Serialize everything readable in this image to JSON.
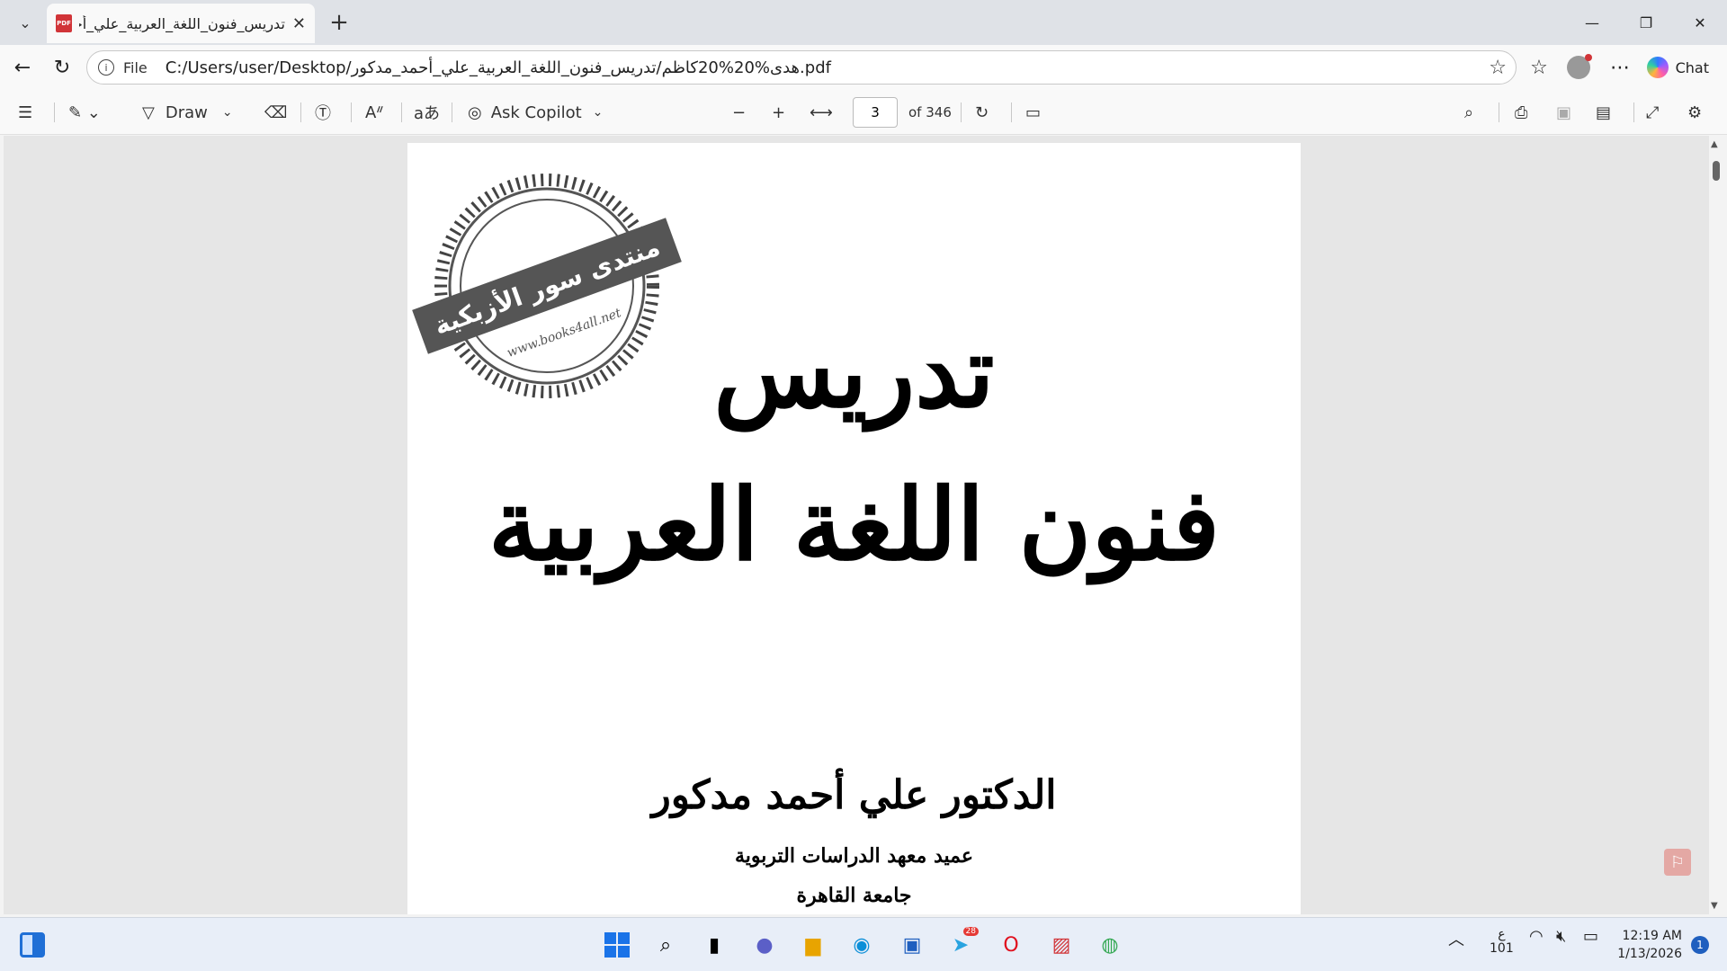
{
  "browser": {
    "tab_title": "تدريس_فنون_اللغة_العربية_علي_أحمد_مدكور",
    "file_label": "File",
    "url": "C:/Users/user/Desktop/هدى%20%20كاظم/تدريس_فنون_اللغة_العربية_علي_أحمد_مدكور.pdf",
    "chat_label": "Chat"
  },
  "pdf_toolbar": {
    "draw_label": "Draw",
    "ask_copilot_label": "Ask Copilot",
    "page_number": "3",
    "page_total": "of 346"
  },
  "document": {
    "title_line1": "تدريس",
    "title_line2": "فنون اللغة العربية",
    "author": "الدكتور علي أحمد مدكور",
    "affiliation": "عميد معهد الدراسات التربوية",
    "university": "جامعة القاهرة",
    "stamp_text": "منتدى سور الأزبكية",
    "stamp_url": "www.books4all.net"
  },
  "taskbar": {
    "telegram_badge": "28",
    "lang_indicator": "ع",
    "lang_sub": "101",
    "time": "12:19 AM",
    "date": "1/13/2026",
    "notification_count": "1"
  }
}
